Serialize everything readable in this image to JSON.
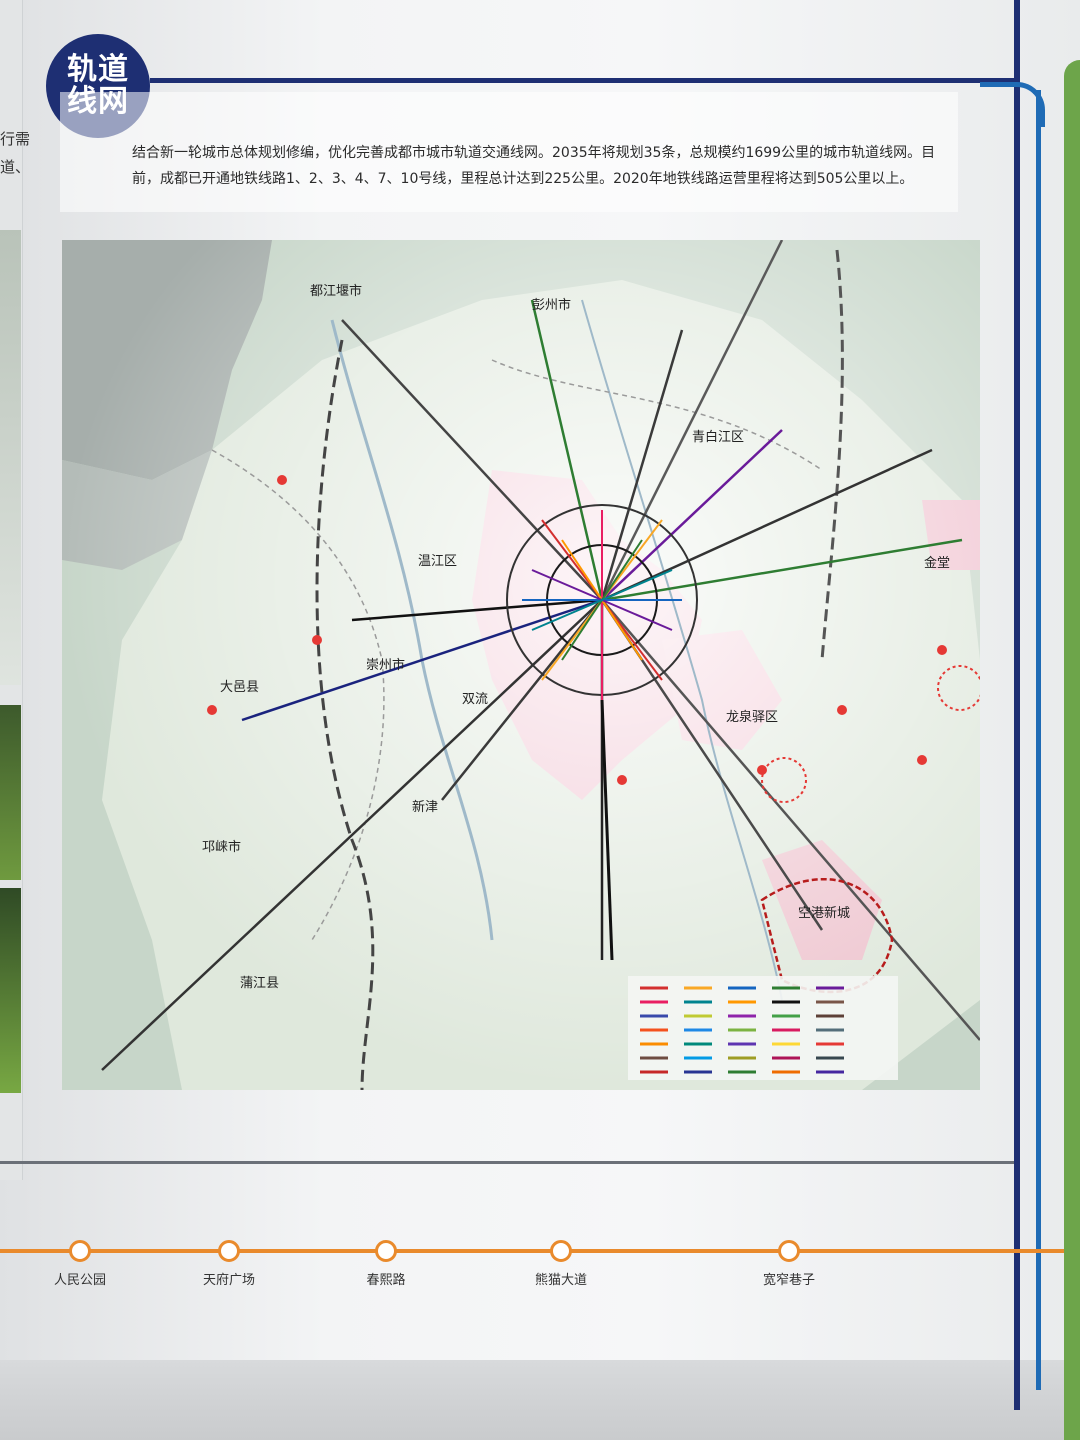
{
  "badge": {
    "line1": "轨道",
    "line2": "线网"
  },
  "intro_text": "结合新一轮城市总体规划修编，优化完善成都市城市轨道交通线网。2035年将规划35条，总规模约1699公里的城市轨道线网。目前，成都已开通地铁线路1、2、3、4、7、10号线，里程总计达到225公里。2020年地铁线路运营里程将达到505公里以上。",
  "left_edge_text": {
    "a": "行需",
    "b": "道、"
  },
  "map_labels": {
    "dujiangyan": "都江堰市",
    "pengzhou": "彭州市",
    "qingbaijiang": "青白江区",
    "wenjiang": "温江区",
    "chongzhou": "崇州市",
    "dayi": "大邑县",
    "shuangliu": "双流",
    "longquanyi": "龙泉驿区",
    "xinjin": "新津",
    "qionglai": "邛崃市",
    "pujiang": "蒲江县",
    "konggang": "空港新城",
    "jintang": "金堂"
  },
  "stations": [
    "人民公园",
    "天府广场",
    "春熙路",
    "熊猫大道",
    "宽窄巷子"
  ],
  "colors": {
    "navy": "#1e2f73",
    "blue": "#1f6bb5",
    "green": "#6da54a",
    "orange": "#e98a2c"
  }
}
